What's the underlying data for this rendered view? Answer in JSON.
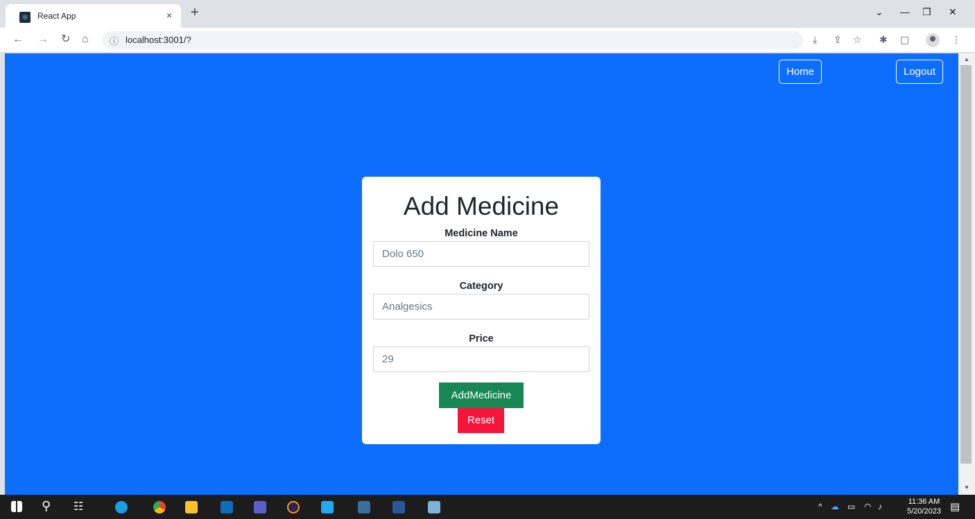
{
  "browser": {
    "tab_title": "React App",
    "tab_close": "×",
    "new_tab": "+",
    "window_controls": [
      "⌄",
      "—",
      "❐",
      "✕"
    ],
    "url": "localhost:3001/?",
    "url_info_icon": "ⓘ"
  },
  "nav": {
    "home_label": "Home",
    "logout_label": "Logout"
  },
  "form": {
    "title": "Add Medicine",
    "medicine_name_label": "Medicine Name",
    "medicine_name_value": "Dolo 650",
    "category_label": "Category",
    "category_value": "Analgesics",
    "price_label": "Price",
    "price_value": "29",
    "add_button_label": "AddMedicine",
    "reset_button_label": "Reset"
  },
  "taskbar": {
    "time": "11:36 AM",
    "date": "5/20/2023"
  },
  "colors": {
    "page_background": "#0d6efd",
    "add_button": "#198754",
    "reset_button": "#f5153c"
  }
}
